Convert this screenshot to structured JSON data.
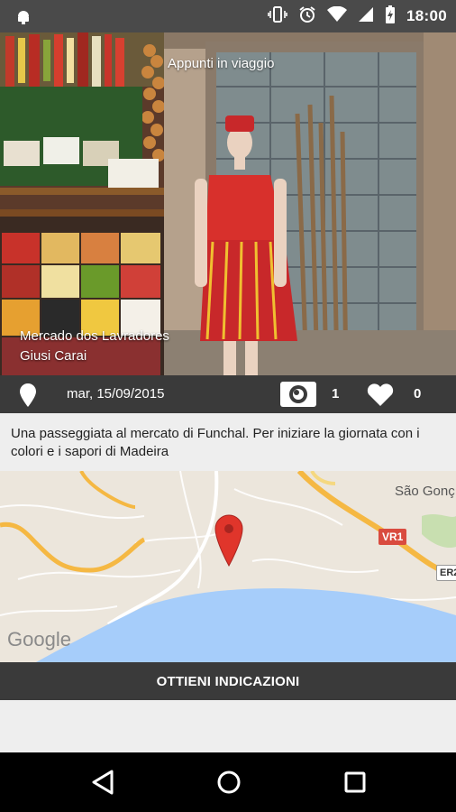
{
  "status_bar": {
    "time": "18:00",
    "icons": [
      "android-icon",
      "vibrate-icon",
      "alarm-icon",
      "wifi-icon",
      "signal-icon",
      "battery-icon"
    ]
  },
  "hero": {
    "title": "Appunti in viaggio",
    "place_name": "Mercado dos Lavradores",
    "author": "Giusi Carai"
  },
  "info_bar": {
    "date": "mar, 15/09/2015",
    "views": "1",
    "likes": "0"
  },
  "description": "Una passeggiata al mercato di Funchal. Per iniziare la giornata con i colori e i sapori di Madeira",
  "map": {
    "place_label": "São Gonç",
    "road_label_1": "VR1",
    "road_label_2": "ER2",
    "attribution": "Google",
    "colors": {
      "land": "#ece6dc",
      "water": "#a6cdfa",
      "highway": "#f5b843",
      "marker": "#e0352b"
    }
  },
  "directions_button": "OTTIENI INDICAZIONI",
  "nav": [
    "back-icon",
    "home-icon",
    "recents-icon"
  ]
}
